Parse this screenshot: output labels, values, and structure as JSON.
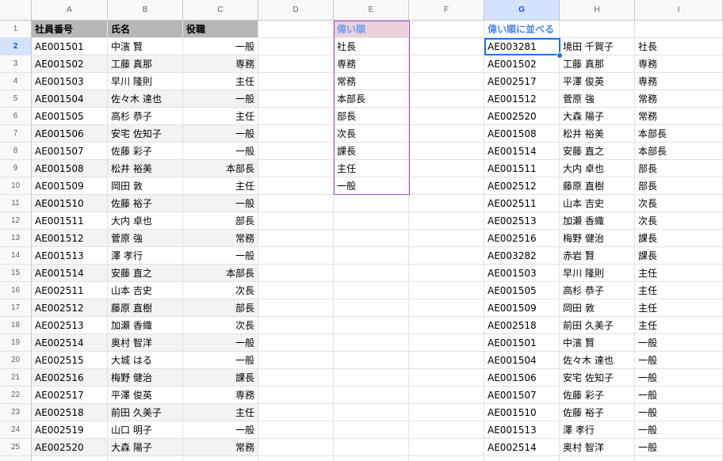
{
  "columns": [
    "A",
    "B",
    "C",
    "D",
    "E",
    "F",
    "G",
    "H",
    "I"
  ],
  "selected_column": "G",
  "selected_row": 2,
  "header": {
    "a": "社員番号",
    "b": "氏名",
    "c": "役職"
  },
  "list_e_header": "偉い順",
  "list_e": [
    "社長",
    "専務",
    "常務",
    "本部長",
    "部長",
    "次長",
    "課長",
    "主任",
    "一般"
  ],
  "sorted_header": "偉い順に並べる",
  "table_a": [
    {
      "id": "AE001501",
      "name": "中濱 賢",
      "title": "一般"
    },
    {
      "id": "AE001502",
      "name": "工藤 真那",
      "title": "専務"
    },
    {
      "id": "AE001503",
      "name": "早川 隆則",
      "title": "主任"
    },
    {
      "id": "AE001504",
      "name": "佐々木 達也",
      "title": "一般"
    },
    {
      "id": "AE001505",
      "name": "高杉 恭子",
      "title": "主任"
    },
    {
      "id": "AE001506",
      "name": "安宅 佐知子",
      "title": "一般"
    },
    {
      "id": "AE001507",
      "name": "佐藤 彩子",
      "title": "一般"
    },
    {
      "id": "AE001508",
      "name": "松井 裕美",
      "title": "本部長"
    },
    {
      "id": "AE001509",
      "name": "岡田 敦",
      "title": "主任"
    },
    {
      "id": "AE001510",
      "name": "佐藤 裕子",
      "title": "一般"
    },
    {
      "id": "AE001511",
      "name": "大内 卓也",
      "title": "部長"
    },
    {
      "id": "AE001512",
      "name": "菅原 強",
      "title": "常務"
    },
    {
      "id": "AE001513",
      "name": "澤 孝行",
      "title": "一般"
    },
    {
      "id": "AE001514",
      "name": "安藤 直之",
      "title": "本部長"
    },
    {
      "id": "AE002511",
      "name": "山本 吉史",
      "title": "次長"
    },
    {
      "id": "AE002512",
      "name": "藤原 直樹",
      "title": "部長"
    },
    {
      "id": "AE002513",
      "name": "加瀬 香織",
      "title": "次長"
    },
    {
      "id": "AE002514",
      "name": "奥村 智洋",
      "title": "一般"
    },
    {
      "id": "AE002515",
      "name": "大城 はる",
      "title": "一般"
    },
    {
      "id": "AE002516",
      "name": "梅野 健治",
      "title": "課長"
    },
    {
      "id": "AE002517",
      "name": "平澤 俊英",
      "title": "専務"
    },
    {
      "id": "AE002518",
      "name": "前田 久美子",
      "title": "主任"
    },
    {
      "id": "AE002519",
      "name": "山口 明子",
      "title": "一般"
    },
    {
      "id": "AE002520",
      "name": "大森 陽子",
      "title": "常務"
    }
  ],
  "table_g": [
    {
      "id": "AE003281",
      "name": "境田 千賀子",
      "title": "社長"
    },
    {
      "id": "AE001502",
      "name": "工藤 真那",
      "title": "専務"
    },
    {
      "id": "AE002517",
      "name": "平澤 俊英",
      "title": "専務"
    },
    {
      "id": "AE001512",
      "name": "菅原 強",
      "title": "常務"
    },
    {
      "id": "AE002520",
      "name": "大森 陽子",
      "title": "常務"
    },
    {
      "id": "AE001508",
      "name": "松井 裕美",
      "title": "本部長"
    },
    {
      "id": "AE001514",
      "name": "安藤 直之",
      "title": "本部長"
    },
    {
      "id": "AE001511",
      "name": "大内 卓也",
      "title": "部長"
    },
    {
      "id": "AE002512",
      "name": "藤原 直樹",
      "title": "部長"
    },
    {
      "id": "AE002511",
      "name": "山本 吉史",
      "title": "次長"
    },
    {
      "id": "AE002513",
      "name": "加瀬 香織",
      "title": "次長"
    },
    {
      "id": "AE002516",
      "name": "梅野 健治",
      "title": "課長"
    },
    {
      "id": "AE003282",
      "name": "赤岩 賢",
      "title": "課長"
    },
    {
      "id": "AE001503",
      "name": "早川 隆則",
      "title": "主任"
    },
    {
      "id": "AE001505",
      "name": "高杉 恭子",
      "title": "主任"
    },
    {
      "id": "AE001509",
      "name": "岡田 敦",
      "title": "主任"
    },
    {
      "id": "AE002518",
      "name": "前田 久美子",
      "title": "主任"
    },
    {
      "id": "AE001501",
      "name": "中濱 賢",
      "title": "一般"
    },
    {
      "id": "AE001504",
      "name": "佐々木 達也",
      "title": "一般"
    },
    {
      "id": "AE001506",
      "name": "安宅 佐知子",
      "title": "一般"
    },
    {
      "id": "AE001507",
      "name": "佐藤 彩子",
      "title": "一般"
    },
    {
      "id": "AE001510",
      "name": "佐藤 裕子",
      "title": "一般"
    },
    {
      "id": "AE001513",
      "name": "澤 孝行",
      "title": "一般"
    },
    {
      "id": "AE002514",
      "name": "奥村 智洋",
      "title": "一般"
    }
  ],
  "colors": {
    "header_gray": "#b7b7b7",
    "band": "#f3f3f3",
    "pink_header": "#ead1dc",
    "list_border": "#a64dd3",
    "selection": "#1a73e8"
  }
}
